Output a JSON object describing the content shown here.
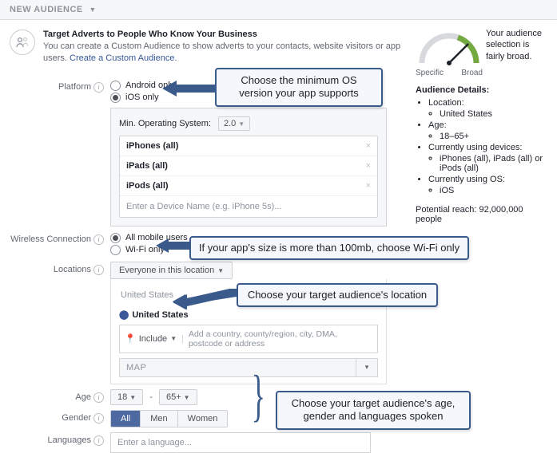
{
  "header": {
    "title": "NEW AUDIENCE"
  },
  "intro": {
    "heading": "Target Adverts to People Who Know Your Business",
    "body": "You can create a Custom Audience to show adverts to your contacts, website visitors or app users. ",
    "link": "Create a Custom Audience."
  },
  "platform": {
    "label": "Platform",
    "opt1": "Android only",
    "opt2": "iOS only",
    "min_label": "Min. Operating System:",
    "min_value": "2.0",
    "devices": [
      "iPhones (all)",
      "iPads (all)",
      "iPods (all)"
    ],
    "placeholder": "Enter a Device Name (e.g. iPhone 5s)..."
  },
  "wifi": {
    "label": "Wireless Connection",
    "opt1": "All mobile users",
    "opt2": "Wi-Fi only"
  },
  "locations": {
    "label": "Locations",
    "scope": "Everyone in this location",
    "selected_hint": "United States",
    "tag": "United States",
    "include": "Include",
    "search_placeholder": "Add a country, county/region, city, DMA, postcode or address",
    "map": "MAP"
  },
  "age": {
    "label": "Age",
    "min": "18",
    "max": "65+"
  },
  "gender": {
    "label": "Gender",
    "all": "All",
    "men": "Men",
    "women": "Women"
  },
  "languages": {
    "label": "Languages",
    "placeholder": "Enter a language..."
  },
  "side": {
    "msg": "Your audience selection is fairly broad.",
    "specific": "Specific",
    "broad": "Broad",
    "details_h": "Audience Details:",
    "loc_h": "Location:",
    "loc_v": "United States",
    "age_h": "Age:",
    "age_v": "18–65+",
    "dev_h": "Currently using devices:",
    "dev_v": "iPhones (all), iPads (all) or iPods (all)",
    "os_h": "Currently using OS:",
    "os_v": "iOS",
    "potential": "Potential reach: 92,000,000 people"
  },
  "callouts": {
    "c1": "Choose the minimum OS version your app supports",
    "c2": "If your app's size is more than 100mb, choose Wi-Fi only",
    "c3": "Choose your target audience's location",
    "c4": "Choose your target audience's age, gender and languages spoken"
  }
}
